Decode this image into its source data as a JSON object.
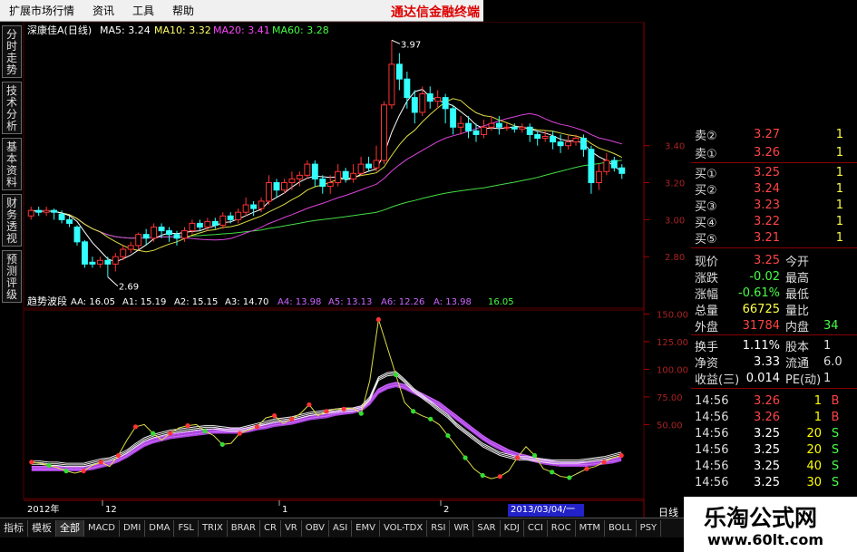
{
  "menu": [
    "扩展市场行情",
    "资讯",
    "工具",
    "帮助"
  ],
  "brand": "通达信金融终端",
  "side_tabs": [
    "分时走势",
    "技术分析",
    "基本资料",
    "财务透视",
    "预测评级"
  ],
  "main_chart": {
    "title": "深康佳A(日线)",
    "ma_labels": [
      {
        "text": "MA5: 3.24",
        "color": "#ffffff"
      },
      {
        "text": "MA10: 3.32",
        "color": "#ffff66"
      },
      {
        "text": "MA20: 3.41",
        "color": "#ff44ff"
      },
      {
        "text": "MA60: 3.28",
        "color": "#44ff44"
      }
    ],
    "y_ticks": [
      "3.40",
      "3.20",
      "3.00",
      "2.80"
    ],
    "high_label": "3.97",
    "low_label": "2.69",
    "candles": [
      [
        3.02,
        3.05,
        3.0,
        3.07
      ],
      [
        3.05,
        3.04,
        3.02,
        3.07
      ],
      [
        3.04,
        3.05,
        3.02,
        3.07
      ],
      [
        3.05,
        3.04,
        3.0,
        3.06
      ],
      [
        3.03,
        3.0,
        2.98,
        3.05
      ],
      [
        3.0,
        2.98,
        2.96,
        3.02
      ],
      [
        2.96,
        2.88,
        2.86,
        2.97
      ],
      [
        2.88,
        2.76,
        2.74,
        2.89
      ],
      [
        2.77,
        2.76,
        2.74,
        2.8
      ],
      [
        2.76,
        2.78,
        2.74,
        2.8
      ],
      [
        2.78,
        2.76,
        2.69,
        2.8
      ],
      [
        2.76,
        2.8,
        2.72,
        2.82
      ],
      [
        2.8,
        2.84,
        2.78,
        2.86
      ],
      [
        2.84,
        2.86,
        2.82,
        2.88
      ],
      [
        2.86,
        2.92,
        2.84,
        2.93
      ],
      [
        2.92,
        2.9,
        2.86,
        2.95
      ],
      [
        2.9,
        2.96,
        2.88,
        2.98
      ],
      [
        2.96,
        2.94,
        2.9,
        2.98
      ],
      [
        2.94,
        2.92,
        2.88,
        2.96
      ],
      [
        2.92,
        2.9,
        2.86,
        2.94
      ],
      [
        2.9,
        2.94,
        2.88,
        2.96
      ],
      [
        2.94,
        2.98,
        2.92,
        3.0
      ],
      [
        2.98,
        2.96,
        2.94,
        3.0
      ],
      [
        2.96,
        2.99,
        2.94,
        3.01
      ],
      [
        2.99,
        2.97,
        2.95,
        3.01
      ],
      [
        2.97,
        3.02,
        2.95,
        3.04
      ],
      [
        3.02,
        3.0,
        2.98,
        3.04
      ],
      [
        3.0,
        3.04,
        2.98,
        3.06
      ],
      [
        3.04,
        3.08,
        3.02,
        3.12
      ],
      [
        3.08,
        3.06,
        3.02,
        3.1
      ],
      [
        3.06,
        3.1,
        3.04,
        3.12
      ],
      [
        3.1,
        3.2,
        3.08,
        3.24
      ],
      [
        3.2,
        3.16,
        3.12,
        3.22
      ],
      [
        3.16,
        3.2,
        3.14,
        3.22
      ],
      [
        3.2,
        3.22,
        3.16,
        3.26
      ],
      [
        3.22,
        3.24,
        3.18,
        3.26
      ],
      [
        3.24,
        3.3,
        3.22,
        3.32
      ],
      [
        3.3,
        3.22,
        3.18,
        3.32
      ],
      [
        3.22,
        3.18,
        3.14,
        3.24
      ],
      [
        3.18,
        3.2,
        3.14,
        3.24
      ],
      [
        3.2,
        3.26,
        3.18,
        3.3
      ],
      [
        3.26,
        3.22,
        3.2,
        3.28
      ],
      [
        3.22,
        3.25,
        3.2,
        3.3
      ],
      [
        3.25,
        3.3,
        3.24,
        3.34
      ],
      [
        3.3,
        3.28,
        3.26,
        3.34
      ],
      [
        3.28,
        3.32,
        3.26,
        3.4
      ],
      [
        3.32,
        3.62,
        3.3,
        3.64
      ],
      [
        3.62,
        3.84,
        3.6,
        3.97
      ],
      [
        3.84,
        3.76,
        3.7,
        3.9
      ],
      [
        3.76,
        3.66,
        3.6,
        3.8
      ],
      [
        3.66,
        3.58,
        3.52,
        3.7
      ],
      [
        3.58,
        3.68,
        3.56,
        3.72
      ],
      [
        3.68,
        3.64,
        3.6,
        3.72
      ],
      [
        3.64,
        3.66,
        3.6,
        3.7
      ],
      [
        3.66,
        3.6,
        3.52,
        3.68
      ],
      [
        3.6,
        3.5,
        3.46,
        3.62
      ],
      [
        3.5,
        3.52,
        3.46,
        3.56
      ],
      [
        3.52,
        3.48,
        3.44,
        3.56
      ],
      [
        3.48,
        3.46,
        3.42,
        3.52
      ],
      [
        3.46,
        3.5,
        3.44,
        3.54
      ],
      [
        3.5,
        3.52,
        3.48,
        3.56
      ],
      [
        3.52,
        3.5,
        3.46,
        3.56
      ],
      [
        3.5,
        3.5,
        3.48,
        3.52
      ],
      [
        3.5,
        3.49,
        3.47,
        3.52
      ],
      [
        3.49,
        3.5,
        3.47,
        3.52
      ],
      [
        3.5,
        3.46,
        3.42,
        3.52
      ],
      [
        3.46,
        3.44,
        3.4,
        3.48
      ],
      [
        3.44,
        3.45,
        3.42,
        3.48
      ],
      [
        3.45,
        3.42,
        3.38,
        3.48
      ],
      [
        3.42,
        3.4,
        3.36,
        3.46
      ],
      [
        3.4,
        3.42,
        3.38,
        3.46
      ],
      [
        3.42,
        3.44,
        3.4,
        3.46
      ],
      [
        3.44,
        3.38,
        3.34,
        3.46
      ],
      [
        3.38,
        3.2,
        3.14,
        3.4
      ],
      [
        3.2,
        3.26,
        3.16,
        3.3
      ],
      [
        3.26,
        3.32,
        3.24,
        3.36
      ],
      [
        3.32,
        3.28,
        3.26,
        3.34
      ],
      [
        3.28,
        3.25,
        3.22,
        3.3
      ]
    ]
  },
  "indicator": {
    "title": "趋势波段",
    "labels": [
      {
        "text": "AA: 16.05",
        "color": "#ffffff"
      },
      {
        "text": "A1: 15.19",
        "color": "#ffffff"
      },
      {
        "text": "A2: 15.15",
        "color": "#ffffff"
      },
      {
        "text": "A3: 14.70",
        "color": "#ffffff"
      },
      {
        "text": "A4: 13.98",
        "color": "#cc66ff"
      },
      {
        "text": "A5: 13.13",
        "color": "#cc66ff"
      },
      {
        "text": "A6: 12.26",
        "color": "#cc66ff"
      },
      {
        "text": "A: 13.98",
        "color": "#cc66ff"
      },
      {
        "text": "16.05",
        "color": "#44ff44"
      }
    ],
    "y_ticks": [
      "150.00",
      "125.00",
      "100.00",
      "75.00",
      "50.00"
    ],
    "aa": [
      16,
      15,
      13,
      11,
      8,
      6,
      8,
      13,
      16,
      12,
      22,
      36,
      48,
      50,
      42,
      36,
      42,
      47,
      49,
      50,
      44,
      40,
      32,
      33,
      42,
      45,
      48,
      56,
      58,
      51,
      55,
      60,
      68,
      58,
      62,
      64,
      64,
      65,
      60,
      90,
      145,
      120,
      95,
      70,
      62,
      58,
      55,
      50,
      40,
      30,
      20,
      10,
      4,
      1,
      3,
      8,
      20,
      30,
      22,
      10,
      7,
      3,
      2,
      6,
      10,
      12,
      16,
      20,
      22
    ],
    "mas": [
      14,
      14,
      13,
      13,
      12,
      12,
      12,
      14,
      16,
      17,
      20,
      24,
      30,
      35,
      38,
      40,
      42,
      43,
      44,
      45,
      46,
      46,
      45,
      44,
      44,
      46,
      48,
      50,
      52,
      53,
      54,
      56,
      58,
      59,
      60,
      61,
      62,
      62,
      64,
      72,
      90,
      94,
      95,
      88,
      80,
      74,
      68,
      62,
      56,
      48,
      42,
      36,
      30,
      26,
      22,
      20,
      18,
      18,
      17,
      16,
      15,
      15,
      15,
      15,
      16,
      17,
      18,
      20,
      22
    ],
    "slow": [
      12,
      12,
      12,
      12,
      12,
      12,
      12,
      13,
      15,
      17,
      20,
      24,
      29,
      34,
      37,
      39,
      41,
      42,
      43,
      44,
      45,
      46,
      46,
      46,
      46,
      47,
      49,
      50,
      52,
      53,
      54,
      56,
      58,
      59,
      60,
      62,
      63,
      64,
      66,
      72,
      82,
      86,
      88,
      86,
      82,
      78,
      74,
      70,
      64,
      58,
      52,
      46,
      40,
      35,
      31,
      27,
      24,
      22,
      20,
      18,
      17,
      16,
      16,
      16,
      16,
      17,
      18,
      19,
      21
    ]
  },
  "quote": {
    "sell": [
      {
        "label": "卖②",
        "price": "3.27",
        "tail": "1"
      },
      {
        "label": "卖①",
        "price": "3.26",
        "tail": "1"
      }
    ],
    "buy": [
      {
        "label": "买①",
        "price": "3.25",
        "tail": "1"
      },
      {
        "label": "买②",
        "price": "3.24",
        "tail": "1"
      },
      {
        "label": "买③",
        "price": "3.23",
        "tail": "1"
      },
      {
        "label": "买④",
        "price": "3.22",
        "tail": "1"
      },
      {
        "label": "买⑤",
        "price": "3.21",
        "tail": "1"
      }
    ],
    "stats": [
      {
        "l1": "现价",
        "v1": "3.25",
        "c1": "#ff4444",
        "l2": "今开",
        "v2": ""
      },
      {
        "l1": "涨跌",
        "v1": "-0.02",
        "c1": "#44ff44",
        "l2": "最高",
        "v2": ""
      },
      {
        "l1": "涨幅",
        "v1": "-0.61%",
        "c1": "#44ff44",
        "l2": "最低",
        "v2": ""
      },
      {
        "l1": "总量",
        "v1": "66725",
        "c1": "#ffff44",
        "l2": "量比",
        "v2": ""
      },
      {
        "l1": "外盘",
        "v1": "31784",
        "c1": "#ff4444",
        "l2": "内盘",
        "v2": "34"
      },
      {
        "l1": "换手",
        "v1": "1.11%",
        "c1": "#ffffff",
        "l2": "股本",
        "v2": "1"
      },
      {
        "l1": "净资",
        "v1": "3.33",
        "c1": "#ffffff",
        "l2": "流通",
        "v2": "6.0"
      },
      {
        "l1": "收益(三)",
        "v1": "0.014",
        "c1": "#ffffff",
        "l2": "PE(动)",
        "v2": "1"
      }
    ],
    "ticks": [
      {
        "time": "14:56",
        "price": "3.26",
        "vol": "1",
        "flag": "B"
      },
      {
        "time": "14:56",
        "price": "3.26",
        "vol": "1",
        "flag": "B"
      },
      {
        "time": "14:56",
        "price": "3.25",
        "vol": "20",
        "flag": "S"
      },
      {
        "time": "14:56",
        "price": "3.25",
        "vol": "20",
        "flag": "S"
      },
      {
        "time": "14:56",
        "price": "3.25",
        "vol": "40",
        "flag": "S"
      },
      {
        "time": "14:56",
        "price": "3.25",
        "vol": "30",
        "flag": "S"
      }
    ]
  },
  "bottom_tabs": [
    "指标",
    "模板",
    "全部",
    "MACD",
    "DMI",
    "DMA",
    "FSL",
    "TRIX",
    "BRAR",
    "CR",
    "VR",
    "OBV",
    "ASI",
    "EMV",
    "VOL-TDX",
    "RSI",
    "WR",
    "SAR",
    "KDJ",
    "CCI",
    "ROC",
    "MTM",
    "BOLL",
    "PSY"
  ],
  "time_axis": {
    "left_label": "2012年",
    "mark1": "12",
    "mark2": "1",
    "mark3": "2",
    "date_tag": "2013/03/04/一",
    "period": "日线"
  },
  "watermark": {
    "title": "乐淘公式网",
    "url": "www.60lt.com"
  }
}
